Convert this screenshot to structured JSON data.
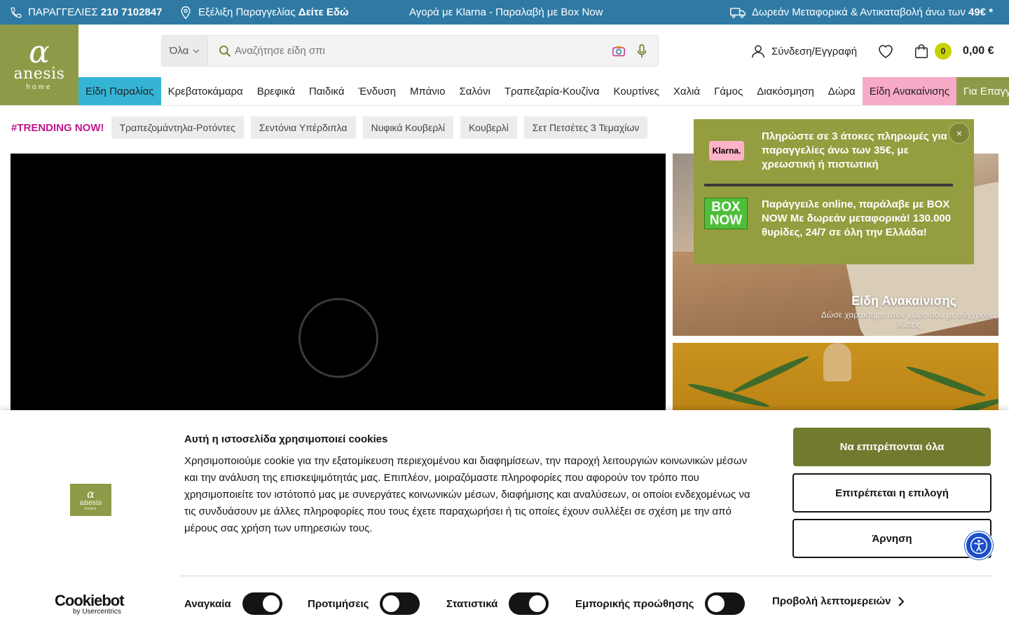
{
  "topbar": {
    "orders_label": "ΠΑΡΑΓΓΕΛΙΕΣ",
    "orders_phone": "210 7102847",
    "tracking_label": "Εξέλιξη Παραγγελίας",
    "tracking_link": "Δείτε Εδώ",
    "klarna_text": "Αγορά με Klarna - Παραλαβή με Box Now",
    "shipping_text": "Δωρεάν Μεταφορικά & Αντικαταβολή άνω των",
    "shipping_amount": "49€ *"
  },
  "logo": {
    "brand": "anesis",
    "sub": "home"
  },
  "search": {
    "category": "Όλα",
    "placeholder": "Αναζήτησε είδη σπι"
  },
  "header": {
    "login_label": "Σύνδεση/Εγγραφή",
    "cart_count": "0",
    "cart_total": "0,00 €"
  },
  "nav": {
    "items": [
      "Είδη Παραλίας",
      "Κρεβατοκάμαρα",
      "Βρεφικά",
      "Παιδικά",
      "Ένδυση",
      "Μπάνιο",
      "Σαλόνι",
      "Τραπεζαρία-Κουζίνα",
      "Κουρτίνες",
      "Χαλιά",
      "Γάμος",
      "Διακόσμηση",
      "Δώρα",
      "Είδη Ανακαίνισης",
      "Για Επαγγ"
    ]
  },
  "trending": {
    "label": "#TRENDING NOW!",
    "chips": [
      "Τραπεζομάντηλα-Ροτόντες",
      "Σεντόνια Υπέρδιπλα",
      "Νυφικά Κουβερλί",
      "Κουβερλί",
      "Σετ Πετσέτες 3 Τεμαχίων"
    ]
  },
  "banners": {
    "renovation_title": "Είδη Ανακαίνισης",
    "renovation_sub": "Δώσε χαρακτήρα στον χώρο σου με σύγχρονες λύσεις"
  },
  "promo": {
    "klarna_logo": "Klarna.",
    "klarna_text": "Πληρώστε σε 3 άτοκες πληρωμές για παραγγελίες άνω των 35€, με χρεωστική ή πιστωτική",
    "boxnow_logo_1": "BOX",
    "boxnow_logo_2": "NOW",
    "boxnow_text": "Παράγγειλε online, παράλαβε με BOX NOW Με δωρεάν μεταφορικά! 130.000 θυρίδες, 24/7 σε όλη την Ελλάδα!",
    "close": "×"
  },
  "cookie": {
    "title": "Αυτή η ιστοσελίδα χρησιμοποιεί cookies",
    "body": "Χρησιμοποιούμε cookie για την εξατομίκευση περιεχομένου και διαφημίσεων, την παροχή λειτουργιών κοινωνικών μέσων και την ανάλυση της επισκεψιμότητάς μας. Επιπλέον, μοιραζόμαστε πληροφορίες που αφορούν τον τρόπο που χρησιμοποιείτε τον ιστότοπό μας με συνεργάτες κοινωνικών μέσων, διαφήμισης και αναλύσεων, οι οποίοι ενδεχομένως να τις συνδυάσουν με άλλες πληροφορίες που τους έχετε παραχωρήσει ή τις οποίες έχουν συλλέξει σε σχέση με την από μέρους σας χρήση των υπηρεσιών τους.",
    "allow_all": "Να επιτρέπονται όλα",
    "allow_selection": "Επιτρέπεται η επιλογή",
    "deny": "Άρνηση",
    "toggles": [
      {
        "label": "Αναγκαία",
        "state": "on"
      },
      {
        "label": "Προτιμήσεις",
        "state": "off"
      },
      {
        "label": "Στατιστικά",
        "state": "on"
      },
      {
        "label": "Εμπορικής προώθησης",
        "state": "off"
      }
    ],
    "details": "Προβολή λεπτομερειών",
    "cookiebot_name": "Cookiebot",
    "cookiebot_by": "by Usercentrics"
  },
  "colors": {
    "topbar": "#2f7aa5",
    "brand_olive": "#8f9a48",
    "accent_magenta": "#c0168f",
    "cart_badge": "#c8d200",
    "cookie_button": "#727a30"
  }
}
